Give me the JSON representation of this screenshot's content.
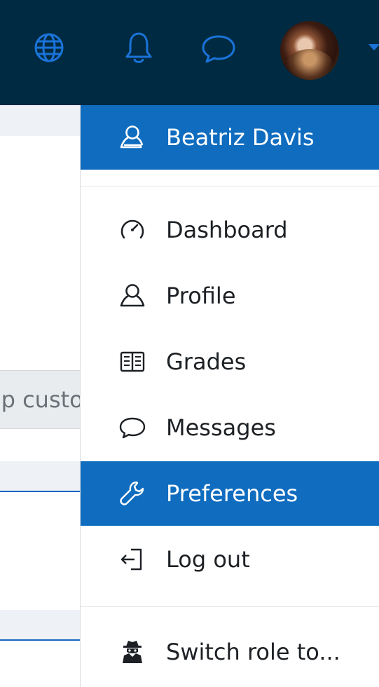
{
  "navbar": {
    "language_icon": "globe-icon",
    "notifications_icon": "bell-icon",
    "messages_icon": "speech-bubble-icon",
    "user_avatar": "avatar-photo",
    "menu_toggle_icon": "caret-down-icon"
  },
  "background": {
    "input_text": "op custo"
  },
  "menu": {
    "user": {
      "label": "Beatriz Davis",
      "icon": "user-icon"
    },
    "items": [
      {
        "label": "Dashboard",
        "icon": "gauge-icon"
      },
      {
        "label": "Profile",
        "icon": "user-icon"
      },
      {
        "label": "Grades",
        "icon": "book-icon"
      },
      {
        "label": "Messages",
        "icon": "speech-bubble-icon"
      },
      {
        "label": "Preferences",
        "icon": "wrench-icon"
      },
      {
        "label": "Log out",
        "icon": "sign-out-icon"
      }
    ],
    "switch_role": {
      "label": "Switch role to...",
      "icon": "user-secret-icon"
    }
  },
  "colors": {
    "navbar_bg": "#002a41",
    "accent_blue": "#0f6cbf",
    "icon_blue": "#1a73d8"
  }
}
